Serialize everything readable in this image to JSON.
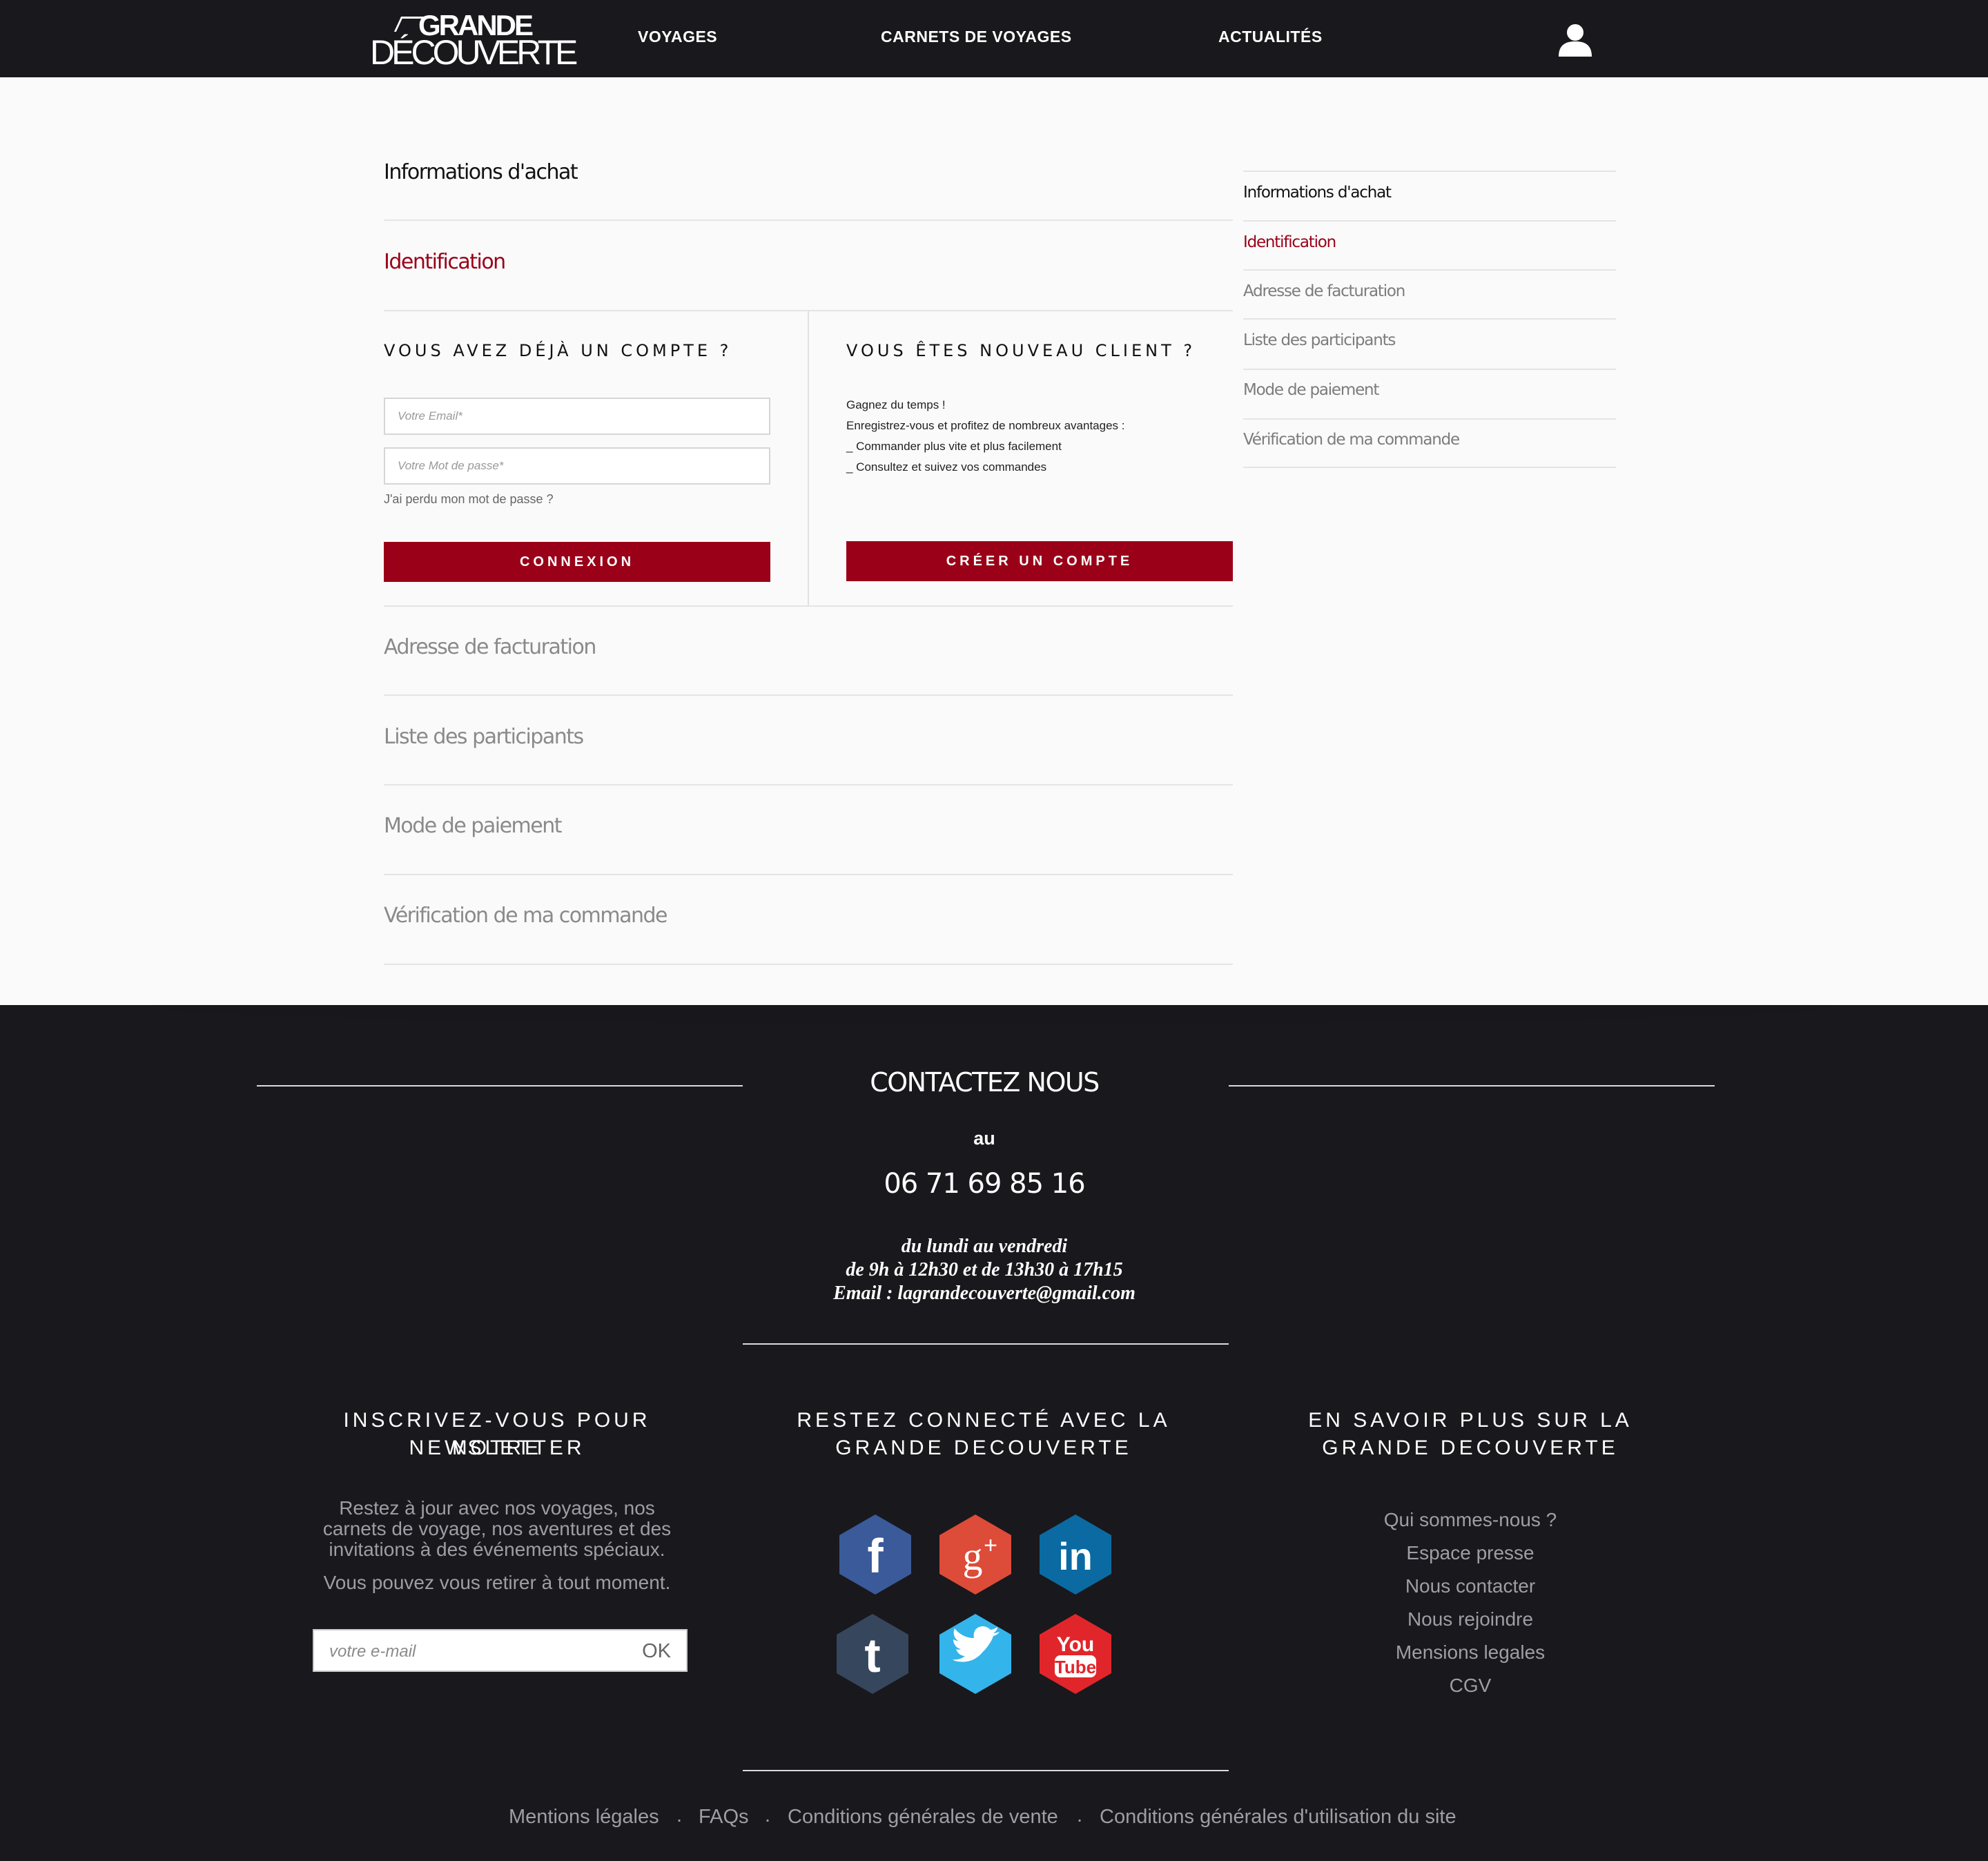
{
  "header": {
    "logo_line1": "GRANDE",
    "logo_line2": "DÉCOUVERTE",
    "nav": [
      "VOYAGES",
      "CARNETS DE VOYAGES",
      "ACTUALITÉS"
    ]
  },
  "steps": {
    "informations": "Informations d'achat",
    "identification": "Identification",
    "facturation": "Adresse de facturation",
    "participants": "Liste des participants",
    "paiement": "Mode de paiement",
    "verification": "Vérification de ma commande"
  },
  "login": {
    "title": "VOUS AVEZ DÉJÀ UN COMPTE ?",
    "email_placeholder": "Votre Email*",
    "password_placeholder": "Votre Mot de passe*",
    "lost_password": "J'ai perdu mon mot de passe ?",
    "button": "CONNEXION"
  },
  "signup": {
    "title": "VOUS ÊTES NOUVEAU CLIENT ?",
    "lines": [
      "Gagnez du temps !",
      "Enregistrez-vous et profitez de nombreux avantages :",
      "_ Commander plus vite et plus facilement",
      "_ Consultez et suivez vos commandes"
    ],
    "button": "CRÉER UN COMPTE"
  },
  "sidebar": [
    "Informations d'achat",
    "Identification",
    "Adresse de facturation",
    "Liste des participants",
    "Mode de paiement",
    "Vérification de ma commande"
  ],
  "contact": {
    "title": "CONTACTEZ NOUS",
    "au": "au",
    "phone": "06 71 69 85 16",
    "days": "du lundi au vendredi",
    "hours": "de 9h à 12h30 et de 13h30 à 17h15",
    "email": "Email : lagrandecouverte@gmail.com"
  },
  "newsletter": {
    "title_line1": "INSCRIVEZ-VOUS POUR NOTRE",
    "title_line2": "NEWSLETTER",
    "text_line1": "Restez à jour avec nos voyages, nos",
    "text_line2": "carnets de voyage, nos aventures et des",
    "text_line3": "invitations à des événements spéciaux.",
    "text_line4": "Vous pouvez vous retirer à tout moment.",
    "placeholder": "votre e-mail",
    "ok": "OK"
  },
  "social": {
    "title_line1": "RESTEZ CONNECTÉ AVEC LA",
    "title_line2": "GRANDE DECOUVERTE",
    "networks": [
      {
        "name": "facebook-icon",
        "glyph": "f",
        "color": "#3b5a9a"
      },
      {
        "name": "google-plus-icon",
        "glyph": "g+",
        "color": "#dd4b39"
      },
      {
        "name": "linkedin-icon",
        "glyph": "in",
        "color": "#0b6aa2"
      },
      {
        "name": "tumblr-icon",
        "glyph": "t",
        "color": "#36465d"
      },
      {
        "name": "twitter-icon",
        "glyph": "",
        "color": "#33b4ea"
      },
      {
        "name": "youtube-icon",
        "glyph": "You Tube",
        "color": "#e1262b"
      }
    ]
  },
  "about": {
    "title_line1": "EN SAVOIR PLUS SUR LA",
    "title_line2": "GRANDE DECOUVERTE",
    "links": [
      "Qui sommes-nous ?",
      "Espace presse",
      "Nous contacter",
      "Nous rejoindre",
      "Mensions legales",
      "CGV"
    ]
  },
  "bottom_links": {
    "mentions": "Mentions légales",
    "faqs": "FAQs",
    "cgv": "Conditions générales de vente",
    "cgu": "Conditions générales d'utilisation du site",
    "separator": "."
  },
  "colors": {
    "accent": "#9a0018",
    "dark": "#19181c",
    "panel": "#fafafa"
  }
}
